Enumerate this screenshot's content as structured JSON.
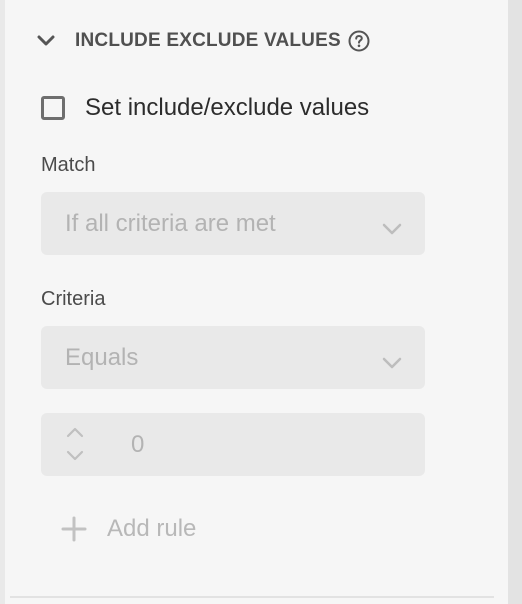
{
  "section": {
    "title": "INCLUDE EXCLUDE VALUES",
    "chevron_icon": "chevron-down-icon",
    "help_icon": "help-circle-icon"
  },
  "checkbox": {
    "label": "Set include/exclude values",
    "checked": false
  },
  "match": {
    "label": "Match",
    "value": "If all criteria are met"
  },
  "criteria": {
    "label": "Criteria",
    "value": "Equals"
  },
  "stepper": {
    "value": "0"
  },
  "add_rule": {
    "label": "Add rule",
    "icon": "plus-icon"
  },
  "colors": {
    "text_dark": "#2c2c2c",
    "text_label": "#4b4b4b",
    "disabled_text": "#b3b3b3",
    "field_bg": "#e9e9e9",
    "panel_bg": "#f6f6f6"
  }
}
